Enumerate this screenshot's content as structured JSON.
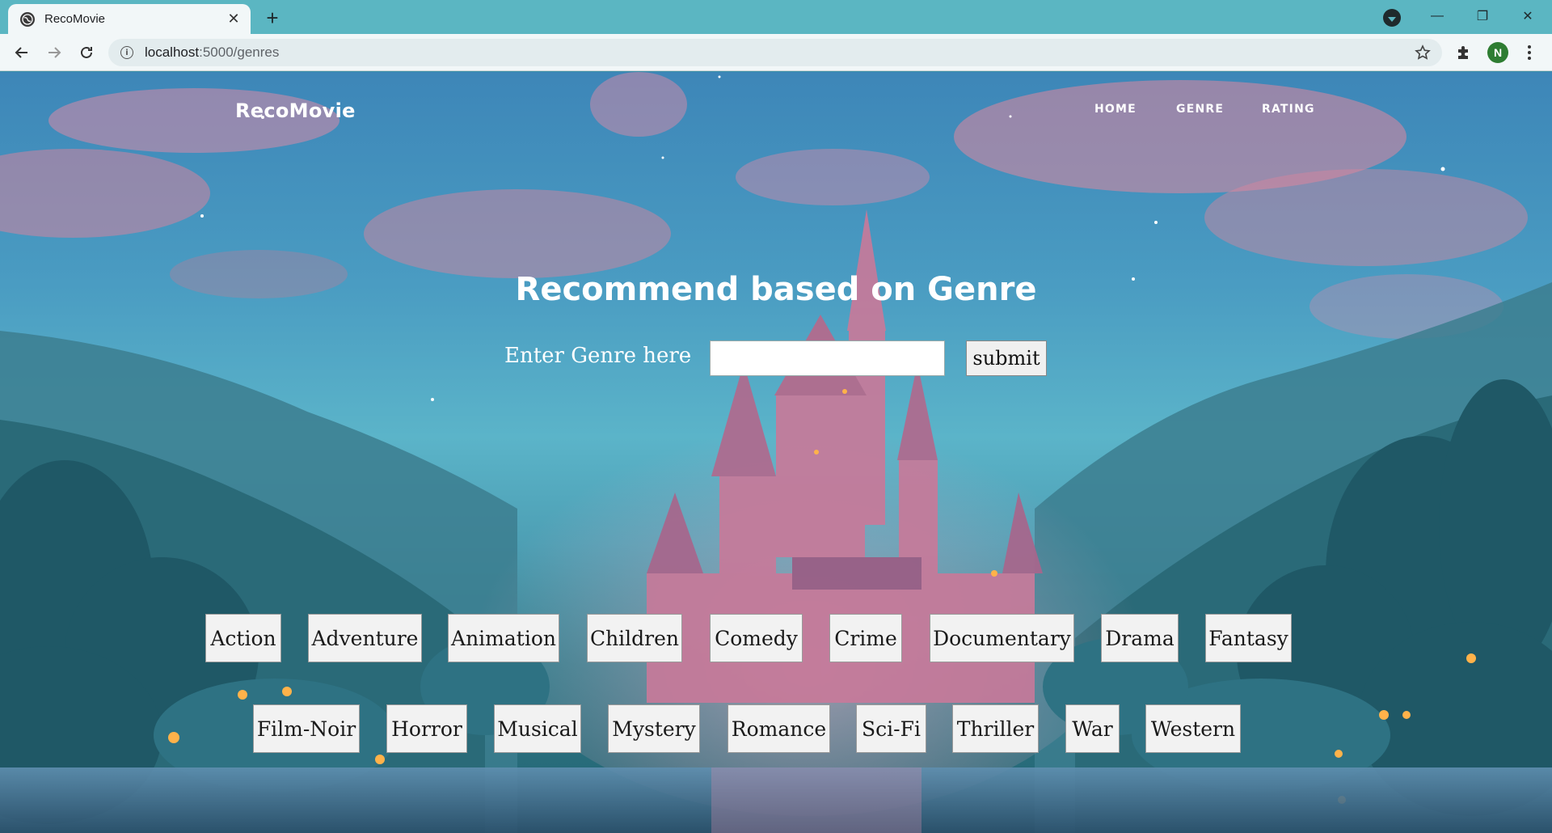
{
  "browser": {
    "tab_title": "RecoMovie",
    "tab_close": "✕",
    "new_tab": "+",
    "url_host": "localhost",
    "url_path": ":5000/genres",
    "avatar_letter": "N",
    "window_minimize": "—",
    "window_restore": "❐",
    "window_close": "✕"
  },
  "site": {
    "brand": "RecoMovie",
    "nav": [
      "HOME",
      "GENRE",
      "RATING"
    ]
  },
  "main": {
    "heading": "Recommend based on Genre",
    "prompt_label": "Enter Genre here",
    "prompt_dash": "-",
    "input_value": "",
    "submit_label": "submit"
  },
  "genres": {
    "row1": [
      "Action",
      "Adventure",
      "Animation",
      "Children",
      "Comedy",
      "Crime",
      "Documentary",
      "Drama",
      "Fantasy"
    ],
    "row2": [
      "Film-Noir",
      "Horror",
      "Musical",
      "Mystery",
      "Romance",
      "Sci-Fi",
      "Thriller",
      "War",
      "Western"
    ]
  }
}
